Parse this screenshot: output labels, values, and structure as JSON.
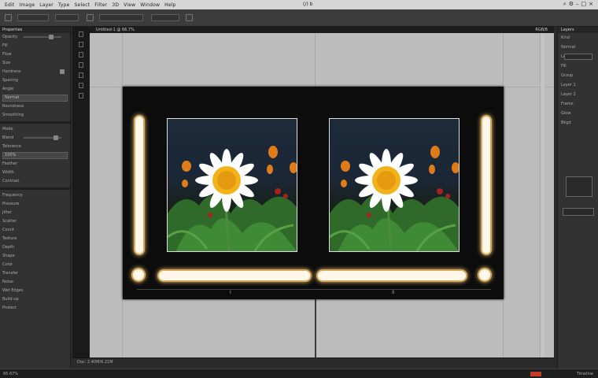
{
  "menubar": {
    "items": [
      "Edit",
      "Image",
      "Layer",
      "Type",
      "Select",
      "Filter",
      "3D",
      "View",
      "Window",
      "Help"
    ],
    "doc_title": "(/) b"
  },
  "left_panel": {
    "header": "Properties",
    "rows": [
      "Opacity",
      "Fill",
      "Flow",
      "Size",
      "Hardness",
      "Spacing",
      "Angle",
      "Roundness",
      "Smoothing",
      "Mode",
      "Blend",
      "Tolerance",
      "Feather",
      "Width",
      "Contrast",
      "Frequency",
      "Pressure",
      "Jitter",
      "Scatter",
      "Count",
      "Texture",
      "Depth",
      "Shape",
      "Color",
      "Transfer",
      "Noise",
      "Wet Edges",
      "Build-up",
      "Protect"
    ],
    "field_a": "Normal",
    "field_b": "100%"
  },
  "document": {
    "tab": "Untitled-1 @ 66.7%",
    "tab_right": "RGB/8",
    "foot_ticks": [
      "I",
      "II"
    ]
  },
  "right_panel": {
    "header": "Layers",
    "rows": [
      "Kind",
      "Normal",
      "Lock",
      "Fill",
      "Group",
      "Layer 1",
      "Layer 2",
      "Frame",
      "Glow",
      "Bkgd"
    ]
  },
  "status": {
    "left": "66.67%",
    "mid": "Doc: 2.40M/6.21M",
    "right": "Timeline"
  },
  "colors": {
    "accent_glow": "#fff7ea",
    "glow_edge": "#d4a95c",
    "status_red": "#c23a2a"
  }
}
